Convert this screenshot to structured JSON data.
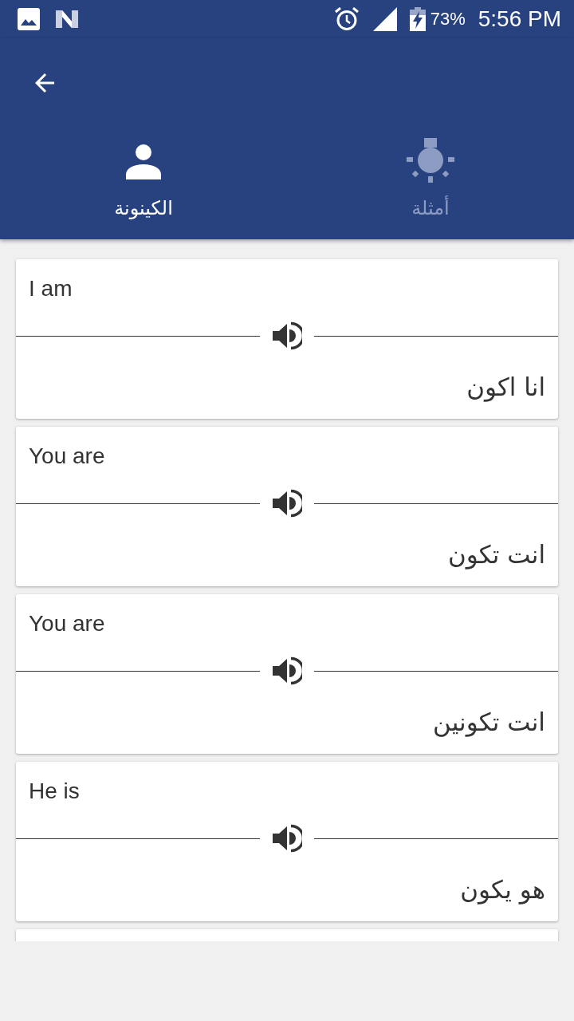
{
  "status_bar": {
    "battery_percent": "73%",
    "time": "5:56 PM"
  },
  "tabs": [
    {
      "label": "أمثلة",
      "selected": false
    },
    {
      "label": "الكينونة",
      "selected": true
    }
  ],
  "phrases": [
    {
      "english": "I am",
      "arabic": "انا اكون"
    },
    {
      "english": "You are",
      "arabic": "انت تكون"
    },
    {
      "english": "You are",
      "arabic": "انت تكونين"
    },
    {
      "english": "He is",
      "arabic": "هو يكون"
    }
  ]
}
